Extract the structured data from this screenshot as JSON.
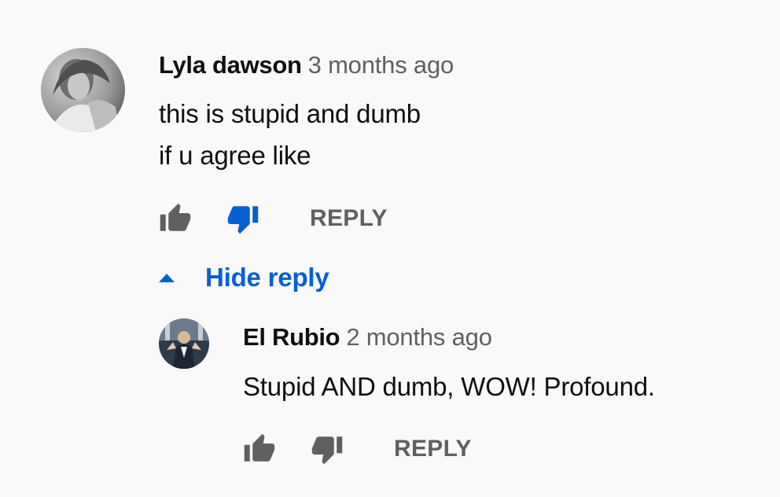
{
  "comment": {
    "author": "Lyla dawson",
    "timestamp": "3 months ago",
    "body_lines": [
      "this is stupid and dumb",
      "if u agree like"
    ],
    "liked": false,
    "disliked": true,
    "reply_label": "REPLY"
  },
  "replies_toggle": {
    "label": "Hide reply",
    "icon": "caret-up-icon"
  },
  "reply": {
    "author": "El Rubio",
    "timestamp": "2 months ago",
    "body_lines": [
      "Stupid AND dumb, WOW! Profound."
    ],
    "liked": false,
    "disliked": false,
    "reply_label": "REPLY"
  },
  "colors": {
    "background": "#f9f9f9",
    "text_primary": "#0f0f0f",
    "text_secondary": "#606060",
    "accent_blue": "#065fd4",
    "icon_inactive": "#606060"
  }
}
